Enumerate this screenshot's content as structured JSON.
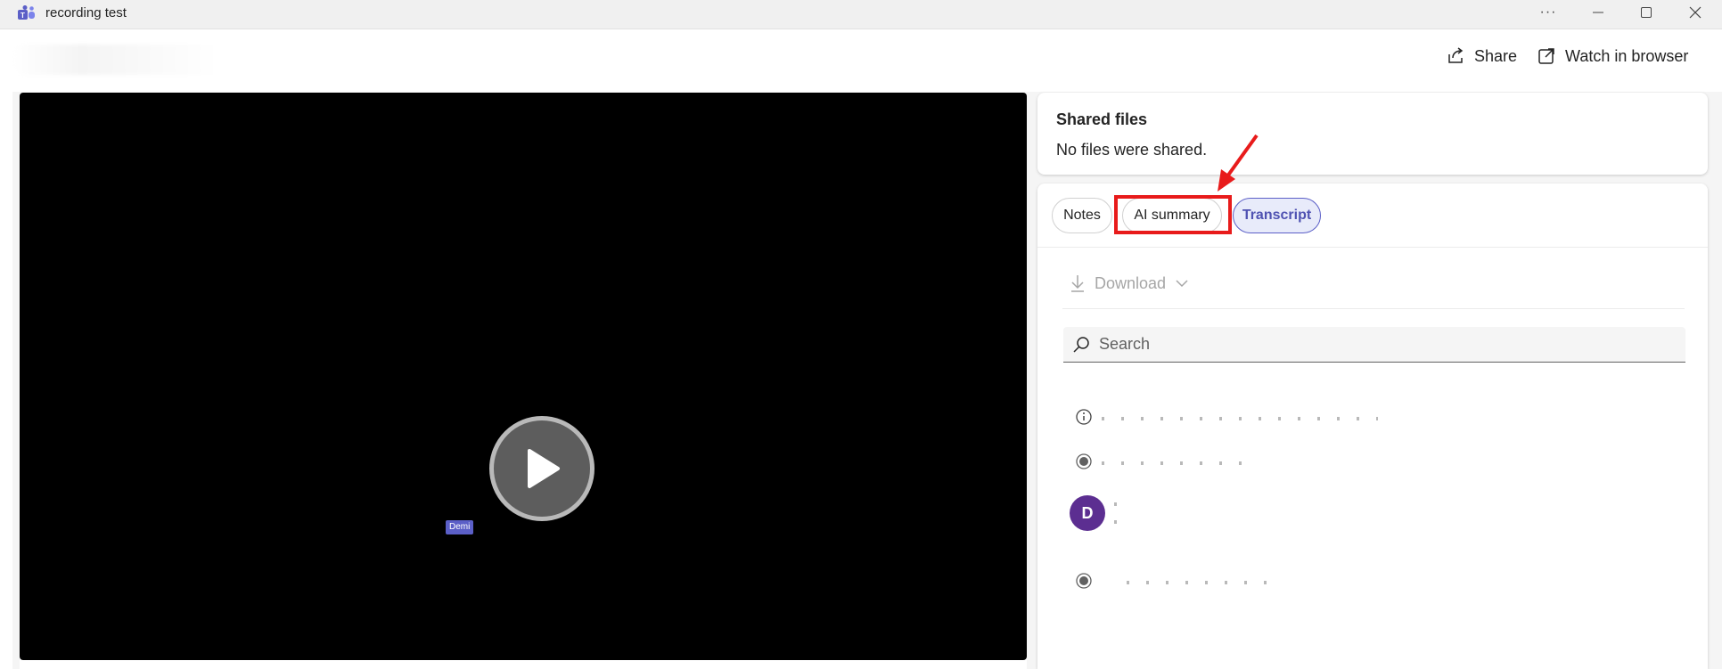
{
  "window": {
    "title": "recording test",
    "controls": [
      "more-options",
      "minimize",
      "maximize",
      "close"
    ],
    "more_label": "···"
  },
  "header": {
    "share_label": "Share",
    "watch_label": "Watch in browser"
  },
  "video": {
    "speaker_tag": "Demi"
  },
  "shared_files": {
    "title": "Shared files",
    "empty_text": "No files were shared."
  },
  "tabs": [
    {
      "label": "Notes",
      "active": false
    },
    {
      "label": "AI summary",
      "active": false
    },
    {
      "label": "Transcript",
      "active": true
    }
  ],
  "transcript": {
    "download_label": "Download",
    "search_placeholder": "Search",
    "avatar_initial": "D"
  },
  "colors": {
    "accent": "#5b5fc7",
    "annotation": "#e81b1b",
    "avatar": "#5c2e91"
  }
}
